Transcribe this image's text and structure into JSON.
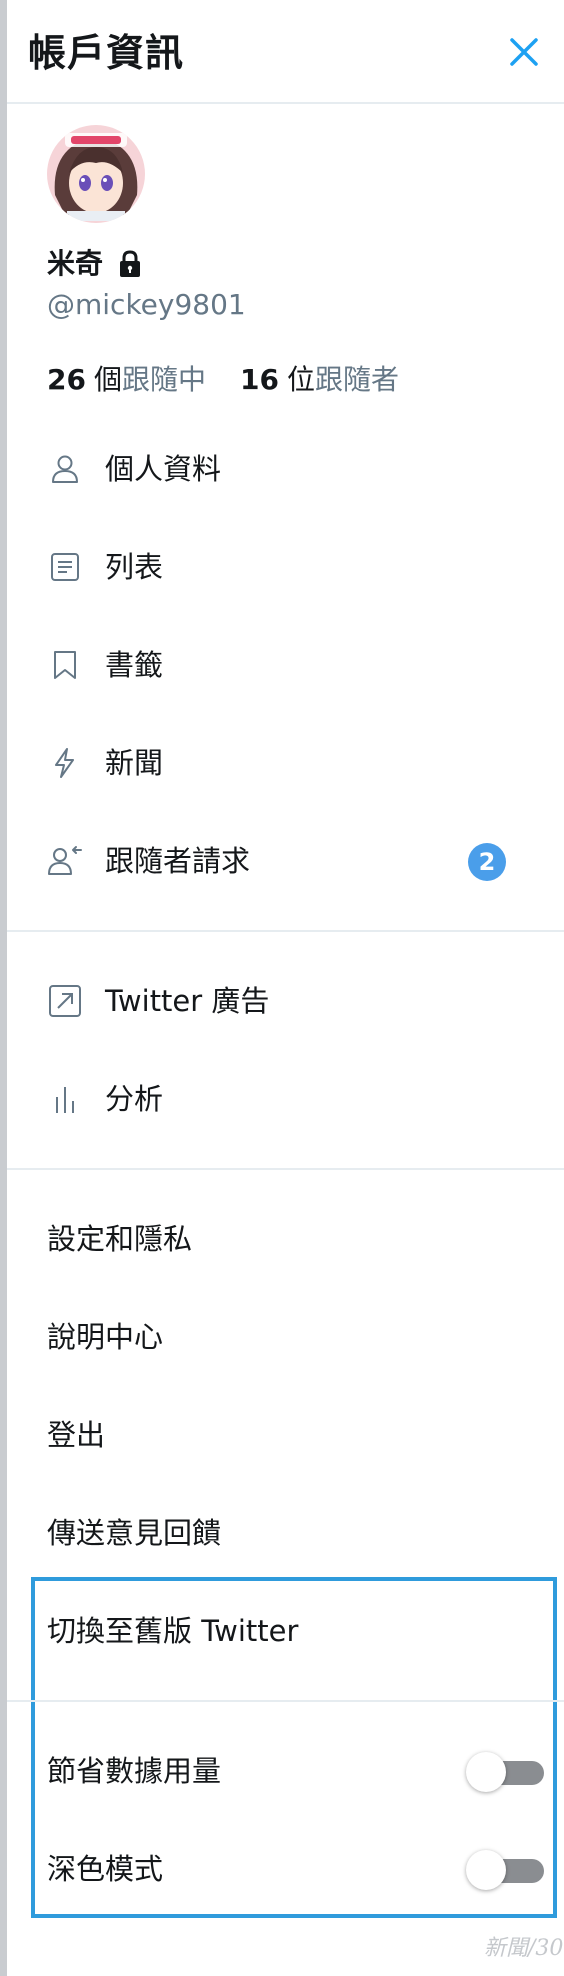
{
  "header": {
    "title": "帳戶資訊",
    "close_icon": "close-icon"
  },
  "profile": {
    "display_name": "米奇",
    "protected_icon": "lock-icon",
    "handle": "@mickey9801",
    "following_count": "26",
    "following_unit": "個",
    "following_label": "跟隨中",
    "followers_count": "16",
    "followers_unit": "位",
    "followers_label": "跟隨者"
  },
  "menu_primary": [
    {
      "label": "個人資料",
      "icon": "person-icon"
    },
    {
      "label": "列表",
      "icon": "list-icon"
    },
    {
      "label": "書籤",
      "icon": "bookmark-icon"
    },
    {
      "label": "新聞",
      "icon": "lightning-icon"
    },
    {
      "label": "跟隨者請求",
      "icon": "follower-request-icon",
      "badge": "2"
    }
  ],
  "menu_secondary": [
    {
      "label": "Twitter 廣告",
      "icon": "external-link-icon"
    },
    {
      "label": "分析",
      "icon": "analytics-icon"
    }
  ],
  "menu_settings": [
    {
      "label": "設定和隱私"
    },
    {
      "label": "說明中心"
    },
    {
      "label": "登出"
    },
    {
      "label": "傳送意見回饋"
    }
  ],
  "highlighted": {
    "switch_label": "切換至舊版 Twitter",
    "data_saver_label": "節省數據用量",
    "data_saver_on": false,
    "dark_mode_label": "深色模式",
    "dark_mode_on": false
  },
  "colors": {
    "accent": "#1da1f2",
    "badge": "#4a9eea",
    "highlight_border": "#2f9bdc",
    "secondary_text": "#657786"
  },
  "watermark": "新聞/30"
}
